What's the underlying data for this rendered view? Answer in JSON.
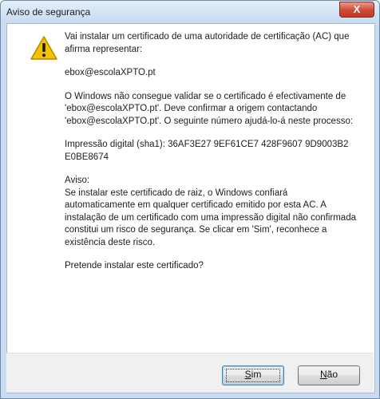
{
  "window": {
    "title": "Aviso de segurança",
    "close_label": "X"
  },
  "message": {
    "intro": "Vai instalar um certificado de uma autoridade de certificação (AC) que afirma representar:",
    "authority": "ebox@escolaXPTO.pt",
    "validation": "O Windows não consegue validar se o certificado é efectivamente de 'ebox@escolaXPTO.pt'. Deve confirmar a origem contactando 'ebox@escolaXPTO.pt'. O seguinte número ajudá-lo-á neste processo:",
    "thumbprint_label": "Impressão digital (sha1): ",
    "thumbprint_value": "36AF3E27 9EF61CE7 428F9607 9D9003B2 E0BE8674",
    "warning_heading": "Aviso:",
    "warning_text": "Se instalar este certificado de raiz, o Windows confiará automaticamente em qualquer certificado emitido por esta AC. A instalação de um certificado com uma impressão digital não confirmada constitui um risco de segurança. Se clicar em 'Sim', reconhece a existência deste risco.",
    "question": "Pretende instalar este certificado?"
  },
  "buttons": {
    "yes_first": "S",
    "yes_rest": "im",
    "no_first": "N",
    "no_rest": "ão"
  },
  "colors": {
    "warning_icon": "#f3c300",
    "close_button": "#c23d27"
  }
}
